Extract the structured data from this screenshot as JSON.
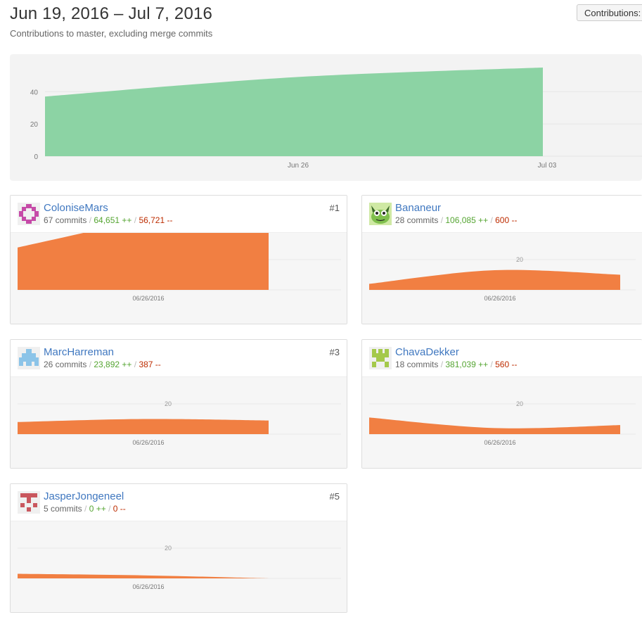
{
  "header": {
    "title": "Jun 19, 2016 – Jul 7, 2016",
    "subtitle": "Contributions to master, excluding merge commits",
    "contributions_button": "Contributions:"
  },
  "colors": {
    "main_area": "#8cd3a4",
    "contributor_area": "#f17f42",
    "link": "#4078c0",
    "additions": "#55a532",
    "deletions": "#bd2c00"
  },
  "chart_data": [
    {
      "type": "area",
      "title": "",
      "x_ticks": [
        "Jun 26",
        "Jul 03"
      ],
      "y_ticks": [
        0,
        20,
        40
      ],
      "ylim": [
        0,
        60
      ],
      "x": [
        "2016-06-19",
        "2016-06-26",
        "2016-07-03"
      ],
      "values": [
        37,
        49,
        55
      ],
      "grid": true
    }
  ],
  "contributors": [
    {
      "name": "ColoniseMars",
      "rank": "#1",
      "commits": "67 commits",
      "additions": "64,651 ++",
      "deletions": "56,721 --",
      "avatar_icon": "pink-cross-identicon",
      "x_label": "06/26/2016",
      "y_tick": "",
      "series": [
        {
          "x": "06/19/2016",
          "y": 28
        },
        {
          "x": "06/26/2016",
          "y": 47
        },
        {
          "x": "07/03/2016",
          "y": 70
        }
      ]
    },
    {
      "name": "Bananeur",
      "rank": "",
      "commits": "28 commits",
      "additions": "106,085 ++",
      "deletions": "600 --",
      "avatar_icon": "frog-avatar",
      "x_label": "06/26/2016",
      "y_tick": "20",
      "series": [
        {
          "x": "06/19/2016",
          "y": 4
        },
        {
          "x": "06/26/2016",
          "y": 13
        },
        {
          "x": "07/03/2016",
          "y": 10
        }
      ]
    },
    {
      "name": "MarcHarreman",
      "rank": "#3",
      "commits": "26 commits",
      "additions": "23,892 ++",
      "deletions": "387 --",
      "avatar_icon": "blue-identicon",
      "x_label": "06/26/2016",
      "y_tick": "20",
      "series": [
        {
          "x": "06/19/2016",
          "y": 8
        },
        {
          "x": "06/26/2016",
          "y": 10
        },
        {
          "x": "07/03/2016",
          "y": 9
        }
      ]
    },
    {
      "name": "ChavaDekker",
      "rank": "",
      "commits": "18 commits",
      "additions": "381,039 ++",
      "deletions": "560 --",
      "avatar_icon": "green-identicon",
      "x_label": "06/26/2016",
      "y_tick": "20",
      "series": [
        {
          "x": "06/19/2016",
          "y": 11
        },
        {
          "x": "06/26/2016",
          "y": 4
        },
        {
          "x": "07/03/2016",
          "y": 6
        }
      ]
    },
    {
      "name": "JasperJongeneel",
      "rank": "#5",
      "commits": "5 commits",
      "additions": "0 ++",
      "deletions": "0 --",
      "avatar_icon": "red-identicon",
      "x_label": "06/26/2016",
      "y_tick": "20",
      "series": [
        {
          "x": "06/19/2016",
          "y": 3
        },
        {
          "x": "06/26/2016",
          "y": 2
        },
        {
          "x": "07/03/2016",
          "y": 0
        }
      ]
    }
  ]
}
